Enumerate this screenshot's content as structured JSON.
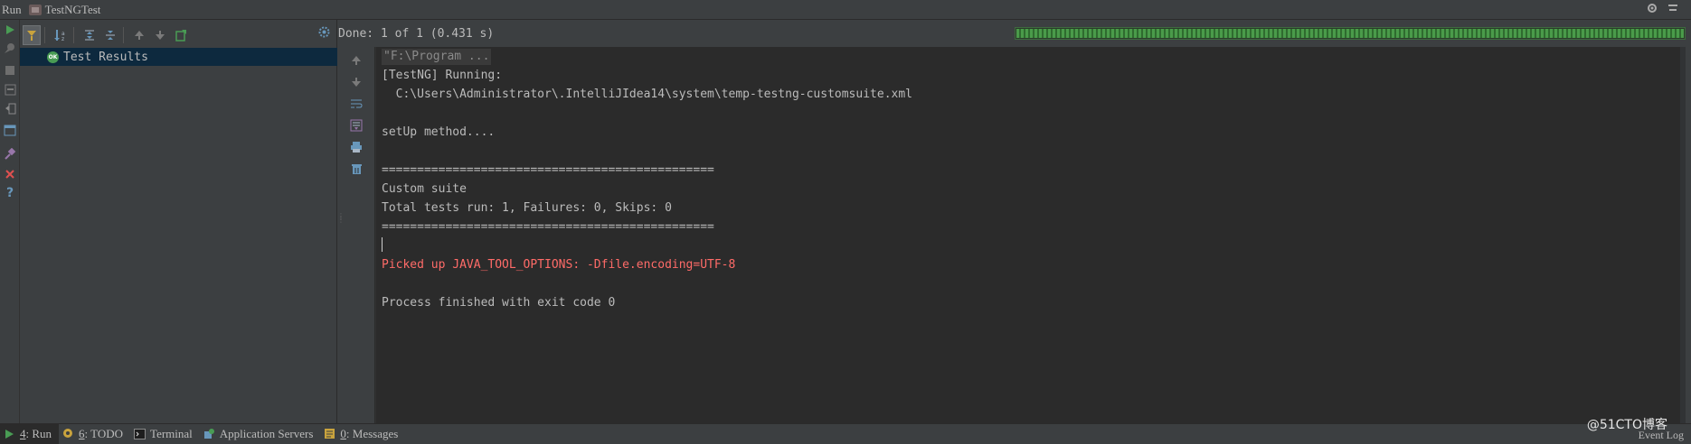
{
  "titlebar": {
    "run_label": "Run",
    "config_name": "TestNGTest"
  },
  "status": {
    "text": "Done: 1 of 1 (0.431 s)",
    "progress_percent": 100
  },
  "tree": {
    "root_label": "Test Results",
    "root_status_badge": "OK"
  },
  "console": {
    "lines": [
      "\"F:\\Program ...",
      "[TestNG] Running:",
      "  C:\\Users\\Administrator\\.IntelliJIdea14\\system\\temp-testng-customsuite.xml",
      "",
      "setUp method....",
      "",
      "===============================================",
      "Custom suite",
      "Total tests run: 1, Failures: 0, Skips: 0",
      "===============================================",
      "",
      "Picked up JAVA_TOOL_OPTIONS: -Dfile.encoding=UTF-8",
      "",
      "Process finished with exit code 0"
    ]
  },
  "bottombar": {
    "run_num": "4",
    "run_label": ": Run",
    "todo_num": "6",
    "todo_label": ": TODO",
    "terminal_label": "Terminal",
    "appservers_label": "Application Servers",
    "messages_num": "0",
    "messages_label": ": Messages",
    "event_log_label": "Event Log"
  },
  "watermark": "@51CTO博客",
  "colors": {
    "background": "#3c3f41",
    "console_bg": "#2b2b2b",
    "error_text": "#ff6b68",
    "success_green": "#499c54",
    "selection": "#0d293e"
  },
  "icons": {
    "left_toolbar": [
      "rerun-icon",
      "rerun-failed-icon",
      "stop-icon",
      "dump-threads-icon",
      "exit-icon",
      "restore-layout-icon",
      "pin-icon",
      "close-icon",
      "help-icon"
    ],
    "console_toolbar": [
      "up-arrow-icon",
      "down-arrow-icon",
      "soft-wrap-icon",
      "scroll-to-end-icon",
      "print-icon",
      "clear-all-icon"
    ]
  }
}
